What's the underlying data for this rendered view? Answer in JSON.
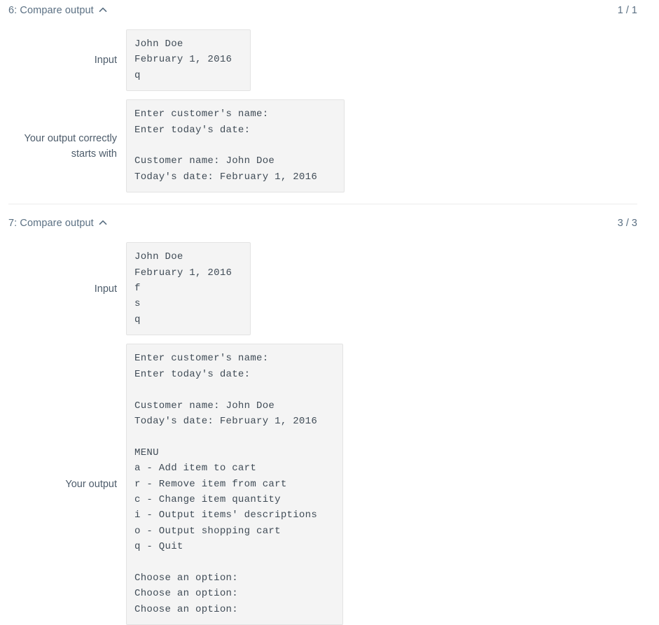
{
  "test_cases": [
    {
      "header": {
        "title": "6: Compare output",
        "toggle_icon": "chevron-up-icon",
        "score": "1 / 1"
      },
      "rows": [
        {
          "label": "Input",
          "content": "John Doe\nFebruary 1, 2016\nq"
        },
        {
          "label": "Your output correctly starts with",
          "content": "Enter customer's name:\nEnter today's date:\n\nCustomer name: John Doe\nToday's date: February 1, 2016"
        }
      ]
    },
    {
      "header": {
        "title": "7: Compare output",
        "toggle_icon": "chevron-up-icon",
        "score": "3 / 3"
      },
      "rows": [
        {
          "label": "Input",
          "content": "John Doe\nFebruary 1, 2016\nf\ns\nq"
        },
        {
          "label": "Your output",
          "content": "Enter customer's name:\nEnter today's date:\n\nCustomer name: John Doe\nToday's date: February 1, 2016\n\nMENU\na - Add item to cart\nr - Remove item from cart\nc - Change item quantity\ni - Output items' descriptions\no - Output shopping cart\nq - Quit\n\nChoose an option:\nChoose an option:\nChoose an option:"
        }
      ]
    }
  ],
  "colors": {
    "header_text": "#5b7083",
    "label_text": "#4d5c6b",
    "code_background": "#f4f4f4",
    "code_border": "#e3e3e3",
    "code_text": "#3f4b56",
    "divider": "#ececec"
  }
}
